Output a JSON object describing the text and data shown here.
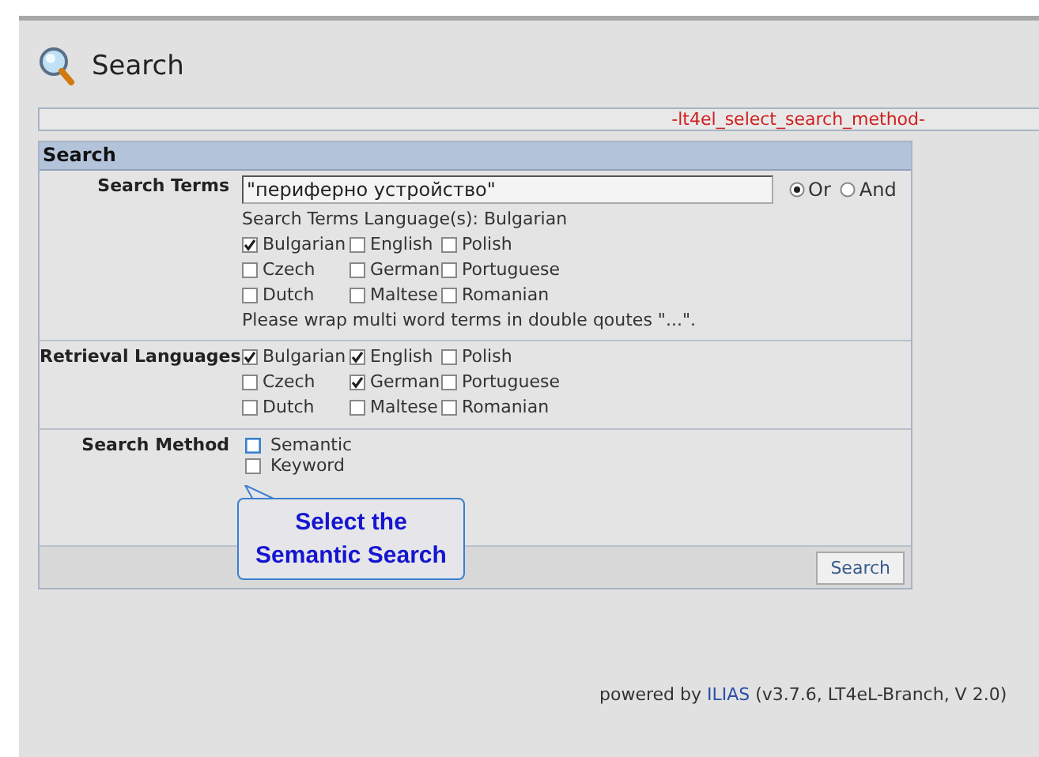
{
  "page": {
    "title": "Search"
  },
  "message": "-lt4el_select_search_method-",
  "form": {
    "header": "Search",
    "search_terms": {
      "label": "Search Terms",
      "value": "\"периферно устройство\"",
      "operators": [
        {
          "label": "Or",
          "selected": true
        },
        {
          "label": "And",
          "selected": false
        }
      ],
      "language_note": "Search Terms Language(s): Bulgarian",
      "languages": [
        {
          "label": "Bulgarian",
          "checked": true
        },
        {
          "label": "English",
          "checked": false
        },
        {
          "label": "Polish",
          "checked": false
        },
        {
          "label": "Czech",
          "checked": false
        },
        {
          "label": "German",
          "checked": false
        },
        {
          "label": "Portuguese",
          "checked": false
        },
        {
          "label": "Dutch",
          "checked": false
        },
        {
          "label": "Maltese",
          "checked": false
        },
        {
          "label": "Romanian",
          "checked": false
        }
      ],
      "hint": "Please wrap multi word terms in double qoutes \"...\"."
    },
    "retrieval": {
      "label": "Retrieval Languages",
      "languages": [
        {
          "label": "Bulgarian",
          "checked": true
        },
        {
          "label": "English",
          "checked": true
        },
        {
          "label": "Polish",
          "checked": false
        },
        {
          "label": "Czech",
          "checked": false
        },
        {
          "label": "German",
          "checked": true
        },
        {
          "label": "Portuguese",
          "checked": false
        },
        {
          "label": "Dutch",
          "checked": false
        },
        {
          "label": "Maltese",
          "checked": false
        },
        {
          "label": "Romanian",
          "checked": false
        }
      ]
    },
    "method": {
      "label": "Search Method",
      "options": [
        {
          "label": "Semantic",
          "checked": false,
          "focused": true
        },
        {
          "label": "Keyword",
          "checked": false,
          "focused": false
        }
      ]
    },
    "submit": "Search"
  },
  "callout": {
    "text": "Select the Semantic Search"
  },
  "footer": {
    "prefix": "powered by ",
    "link": "ILIAS",
    "suffix": " (v3.7.6, LT4eL-Branch, V 2.0)"
  }
}
